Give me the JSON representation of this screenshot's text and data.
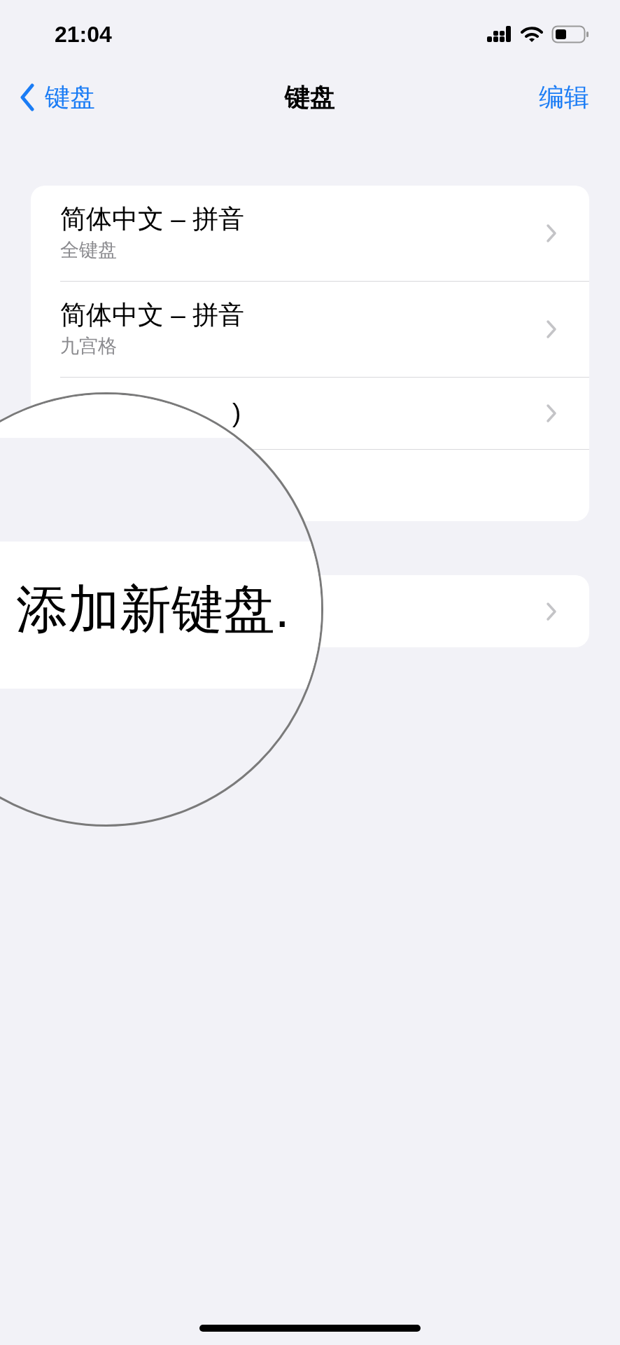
{
  "status_bar": {
    "time": "21:04"
  },
  "nav": {
    "back": "键盘",
    "title": "键盘",
    "action": "编辑"
  },
  "keyboards": [
    {
      "kind": "text",
      "title": "简体中文 – 拼音",
      "subtitle": "全键盘"
    },
    {
      "kind": "text",
      "title": "简体中文 – 拼音",
      "subtitle": "九宫格"
    },
    {
      "kind": "text",
      "title": ")"
    },
    {
      "kind": "covered"
    }
  ],
  "magnifier": {
    "text": "添加新键盘."
  }
}
